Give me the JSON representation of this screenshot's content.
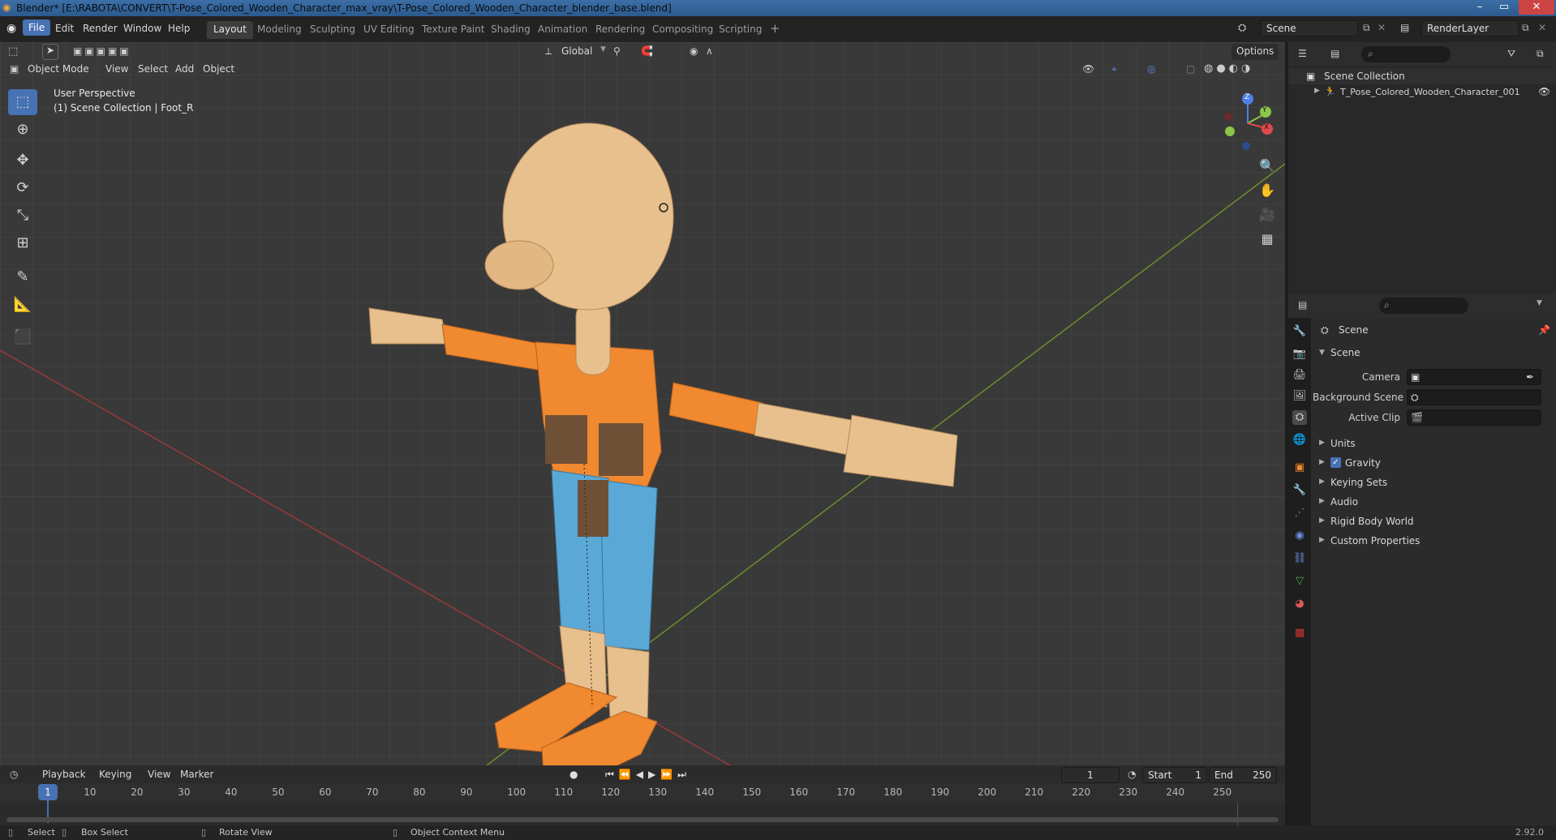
{
  "window": {
    "title": "Blender* [E:\\RABOTA\\CONVERT\\T-Pose_Colored_Wooden_Character_max_vray\\T-Pose_Colored_Wooden_Character_blender_base.blend]",
    "minimize": "–",
    "maximize": "▭",
    "close": "✕"
  },
  "menu": [
    "File",
    "Edit",
    "Render",
    "Window",
    "Help"
  ],
  "workspaces": [
    "Layout",
    "Modeling",
    "Sculpting",
    "UV Editing",
    "Texture Paint",
    "Shading",
    "Animation",
    "Rendering",
    "Compositing",
    "Scripting"
  ],
  "workspace_add": "+",
  "scene_field": "Scene",
  "renderlayer_field": "RenderLayer",
  "viewport_header": {
    "transform_orientation": "Global",
    "options": "Options",
    "mode": "Object Mode",
    "menus": [
      "View",
      "Select",
      "Add",
      "Object"
    ]
  },
  "viewport_info": {
    "perspective": "User Perspective",
    "collection": "(1) Scene Collection | Foot_R"
  },
  "gizmo": {
    "z": "Z",
    "y": "Y",
    "x": "X"
  },
  "outliner": {
    "root": "Scene Collection",
    "items": [
      "T_Pose_Colored_Wooden_Character_001"
    ]
  },
  "properties": {
    "context": "Scene",
    "panel": "Scene",
    "fields": [
      {
        "label": "Camera"
      },
      {
        "label": "Background Scene"
      },
      {
        "label": "Active Clip"
      }
    ],
    "sections": [
      "Units",
      "Gravity",
      "Keying Sets",
      "Audio",
      "Rigid Body World",
      "Custom Properties"
    ]
  },
  "timeline": {
    "menus": [
      "Playback",
      "Keying",
      "View",
      "Marker"
    ],
    "current_frame": "1",
    "start_label": "Start",
    "start": "1",
    "end_label": "End",
    "end": "250",
    "ticks": [
      "1",
      "10",
      "20",
      "30",
      "40",
      "50",
      "60",
      "70",
      "80",
      "90",
      "100",
      "110",
      "120",
      "130",
      "140",
      "150",
      "160",
      "170",
      "180",
      "190",
      "200",
      "210",
      "220",
      "230",
      "240",
      "250"
    ]
  },
  "statusbar": {
    "items": [
      "Select",
      "Box Select",
      "Rotate View",
      "Object Context Menu"
    ],
    "version": "2.92.0"
  },
  "colors": {
    "accent": "#4772b3",
    "wood_light": "#e7c08e",
    "orange": "#f0892f",
    "blue": "#5aa8d6",
    "brown": "#6e5037"
  }
}
